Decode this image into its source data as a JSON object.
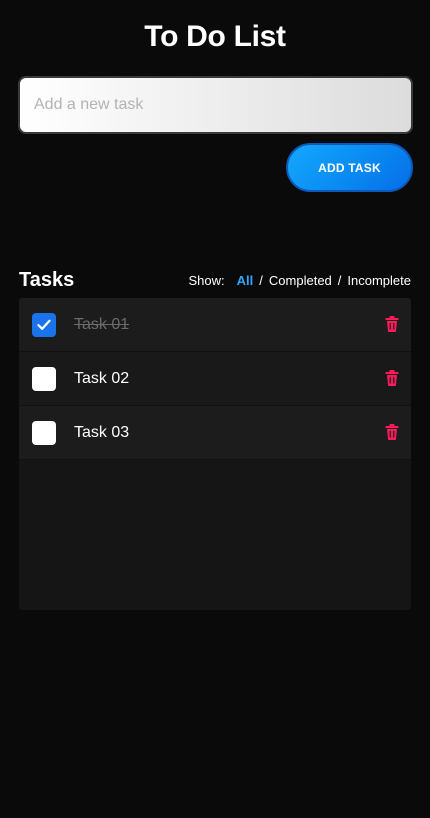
{
  "app": {
    "title": "To Do List"
  },
  "input": {
    "placeholder": "Add a new task",
    "value": ""
  },
  "add_button": {
    "label": "ADD TASK"
  },
  "tasks_section": {
    "title": "Tasks",
    "filter": {
      "label": "Show:",
      "options": [
        "All",
        "Completed",
        "Incomplete"
      ],
      "active": "All",
      "separator": "/"
    }
  },
  "tasks": [
    {
      "label": "Task 01",
      "completed": true
    },
    {
      "label": "Task 02",
      "completed": false
    },
    {
      "label": "Task 03",
      "completed": false
    }
  ],
  "colors": {
    "accent": "#0a8df2",
    "active_filter": "#2ea6ff",
    "checked": "#1a73e8",
    "delete": "#ff1a5a",
    "background": "#0a0a0a"
  },
  "icons": {
    "check": "check-icon",
    "delete": "trash-icon"
  }
}
